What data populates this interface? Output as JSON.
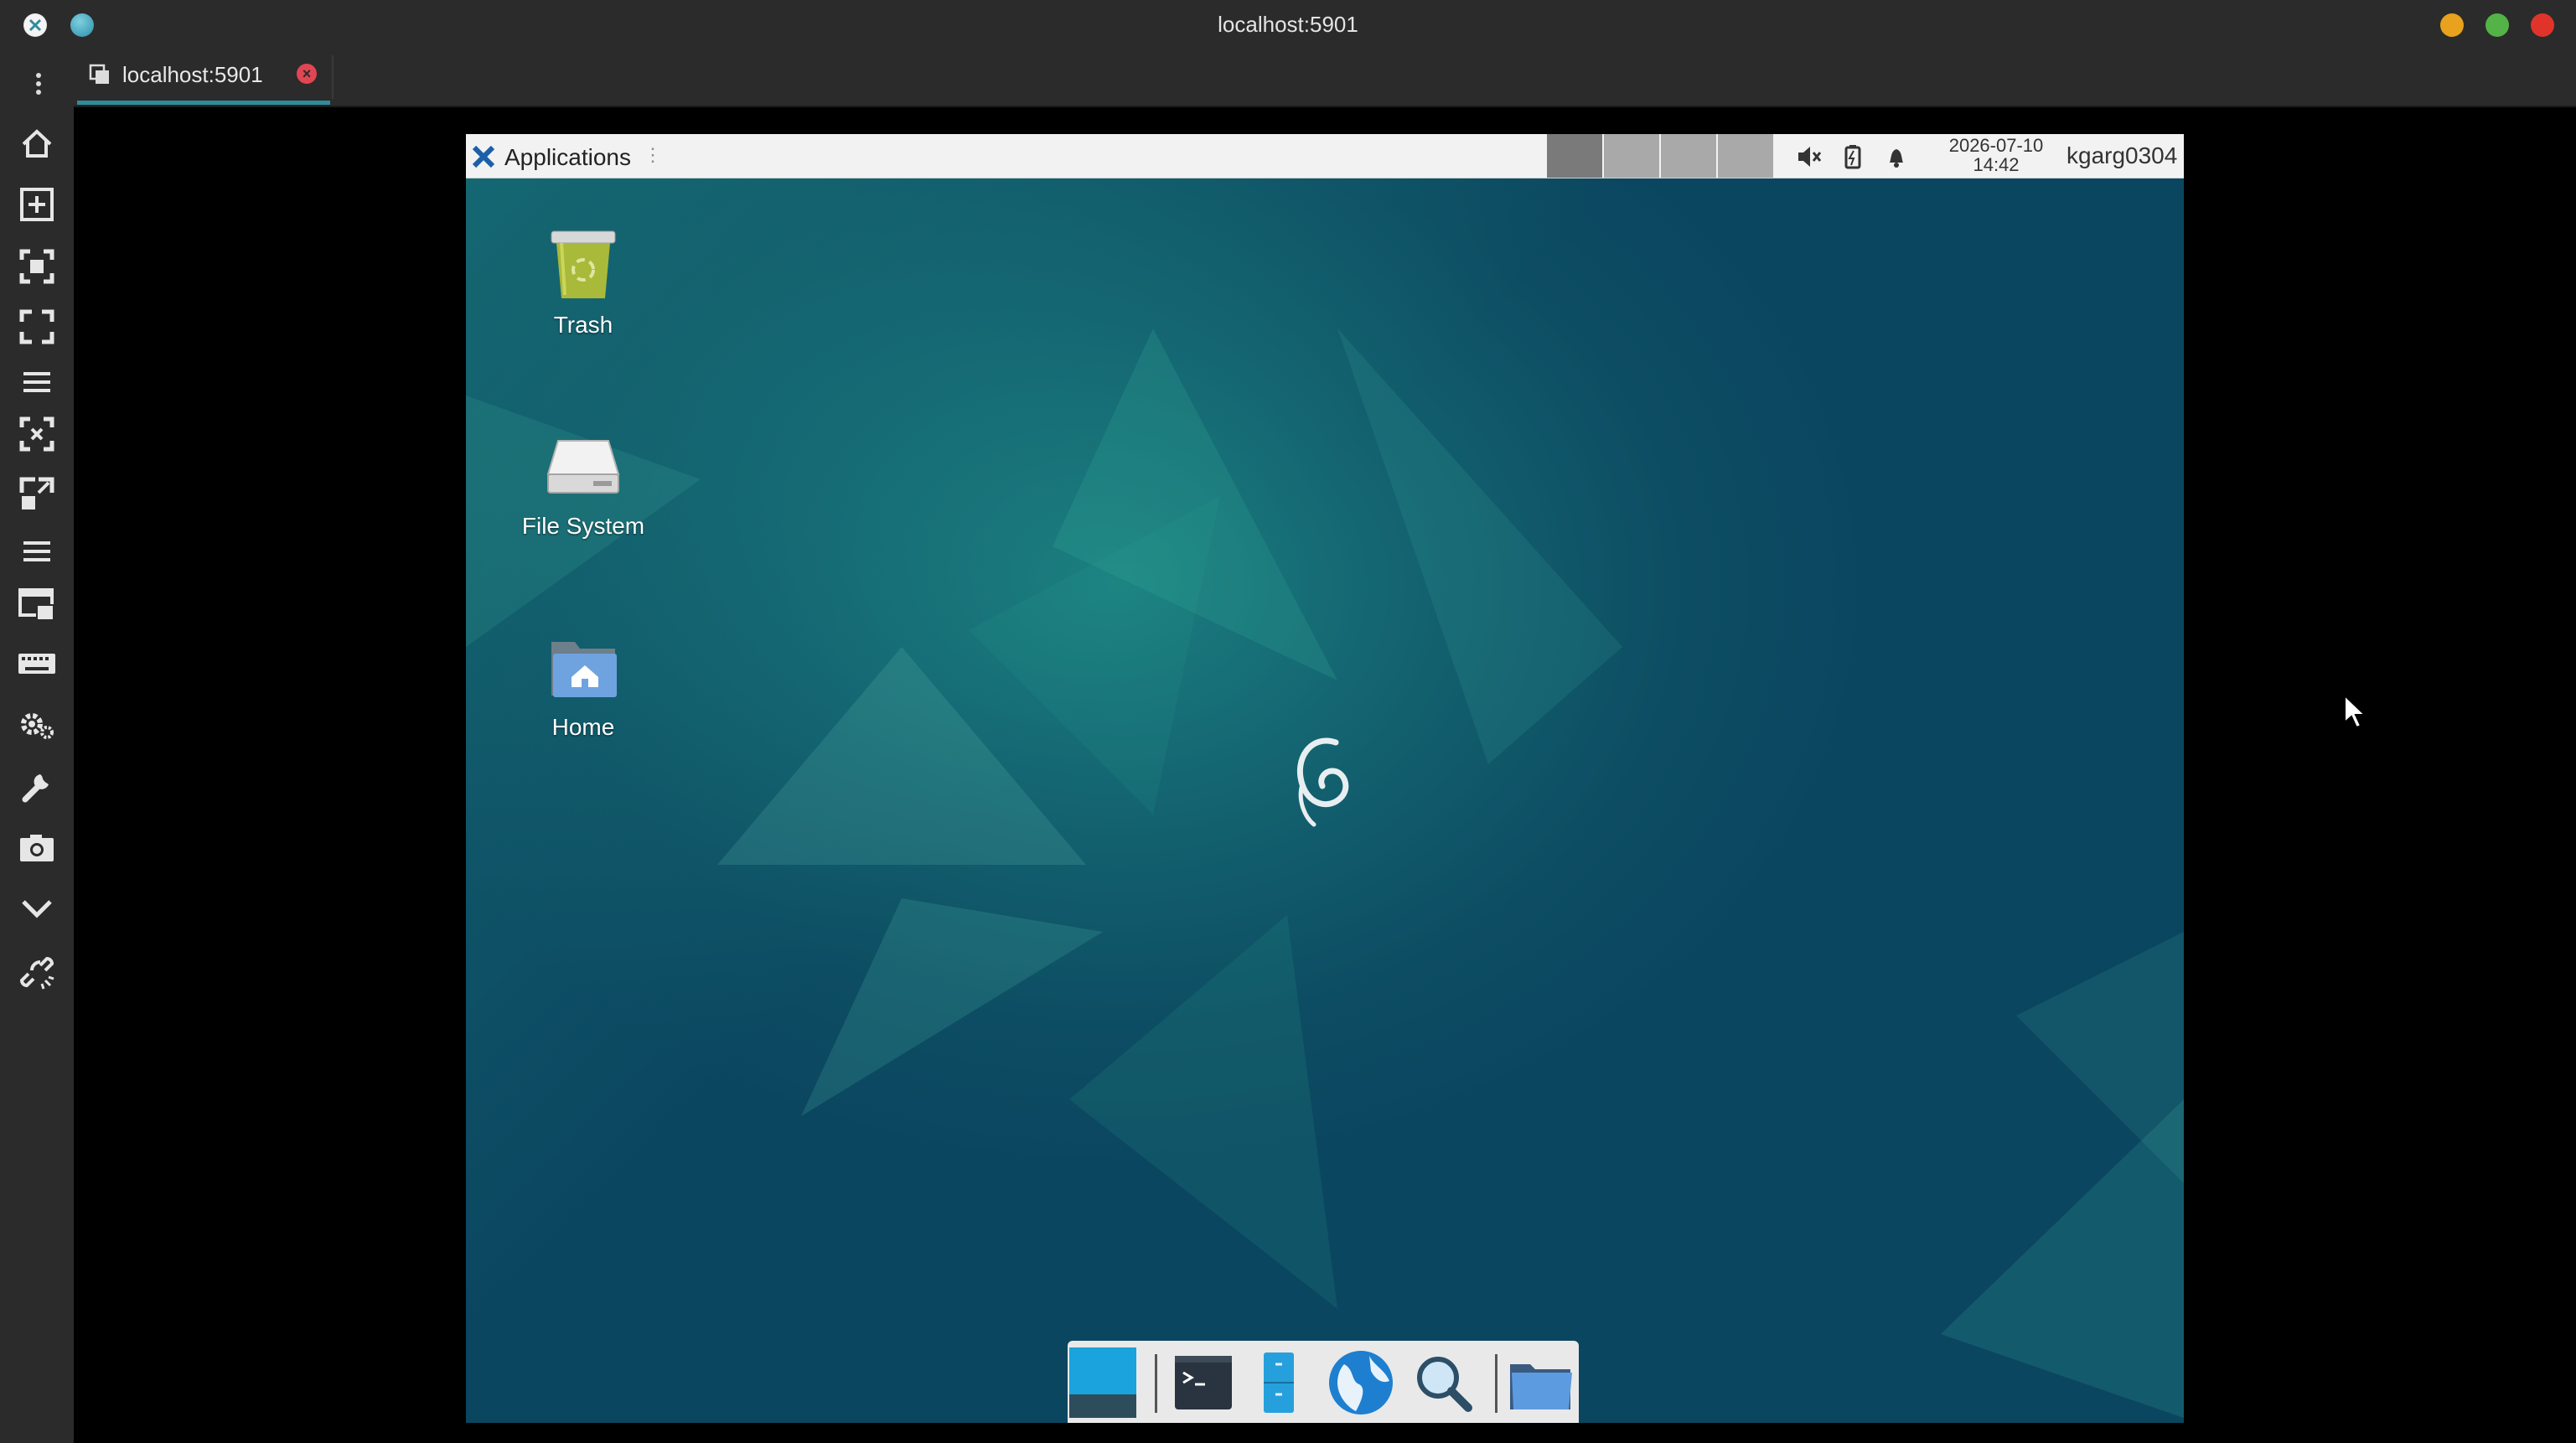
{
  "window": {
    "title": "localhost:5901"
  },
  "tabs": [
    {
      "label": "localhost:5901",
      "close_icon": "close-circle-icon"
    }
  ],
  "sidebar": {
    "buttons": [
      {
        "icon": "home-icon"
      },
      {
        "icon": "new-tab-icon"
      },
      {
        "icon": "scale-to-window-icon"
      },
      {
        "icon": "fullscreen-icon"
      },
      {
        "icon": "menu-lines-icon"
      },
      {
        "icon": "fit-window-icon"
      },
      {
        "icon": "resize-icon"
      },
      {
        "icon": "menu-lines-icon"
      },
      {
        "icon": "multi-monitor-icon"
      },
      {
        "icon": "keyboard-icon"
      },
      {
        "icon": "settings-icon"
      },
      {
        "icon": "tools-icon"
      },
      {
        "icon": "screenshot-icon"
      },
      {
        "icon": "chevron-down-icon"
      },
      {
        "icon": "disconnect-icon"
      }
    ]
  },
  "remote": {
    "panel": {
      "applications_label": "Applications",
      "clock_date": "2026-07-10",
      "clock_time": "14:42",
      "username": "kgarg0304",
      "tray": [
        "mute-icon",
        "battery-icon",
        "bell-icon"
      ]
    },
    "desktop_icons": [
      {
        "label": "Trash",
        "icon": "trash-icon"
      },
      {
        "label": "File System",
        "icon": "drive-icon"
      },
      {
        "label": "Home",
        "icon": "home-folder-icon"
      }
    ],
    "dock": [
      "show-desktop-icon",
      "terminal-icon",
      "file-manager-icon",
      "web-browser-icon",
      "app-finder-icon",
      "folder-icon"
    ]
  },
  "colors": {
    "accent": "#2f8c9b",
    "close_red": "#e04653",
    "win_min": "#e8a21d",
    "win_max": "#53b346",
    "win_close": "#e0342b"
  }
}
